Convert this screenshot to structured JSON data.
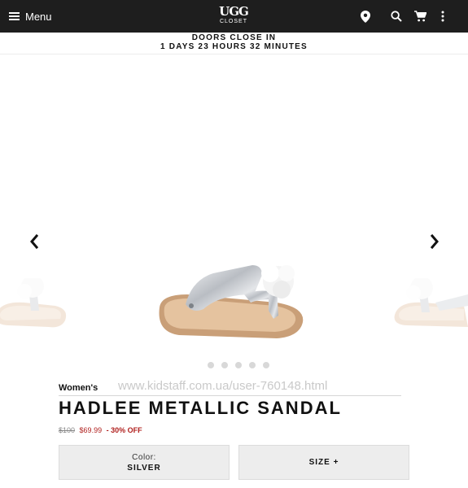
{
  "header": {
    "menu_label": "Menu",
    "logo_main": "UGG",
    "logo_sub": "CLOSET",
    "icons": [
      "map-pin-icon",
      "search-icon",
      "cart-icon",
      "more-vertical-icon"
    ]
  },
  "countdown": {
    "line1": "DOORS CLOSE IN",
    "line2": "1 DAYS 23 HOURS 32 MINUTES"
  },
  "carousel": {
    "slide_count": 5,
    "active_index": 0
  },
  "watermark": "www.kidstaff.com.ua/user-760148.html",
  "product": {
    "category": "Women's",
    "name": "HADLEE METALLIC SANDAL",
    "price_original": "$100",
    "price_sale": "$69.99",
    "discount": "- 30% OFF",
    "color_label": "Color:",
    "color_value": "SILVER",
    "size_label": "SIZE +"
  },
  "colors": {
    "header_bg": "#1e1e1e",
    "sale_red": "#b0201e",
    "button_bg": "#ededed"
  }
}
